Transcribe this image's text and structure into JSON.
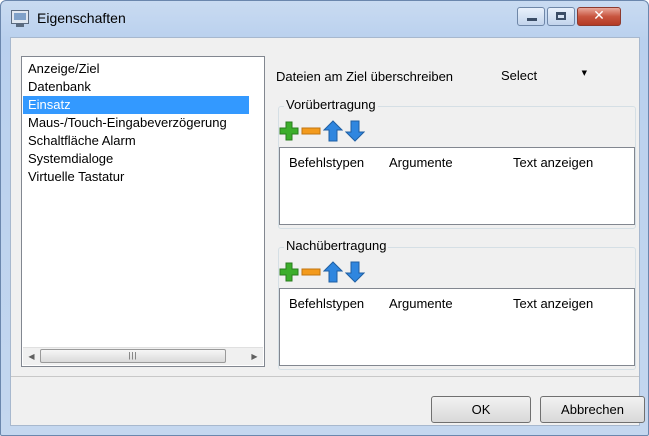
{
  "window": {
    "title": "Eigenschaften"
  },
  "sidebar": {
    "items": [
      {
        "label": "Anzeige/Ziel",
        "selected": false
      },
      {
        "label": "Datenbank",
        "selected": false
      },
      {
        "label": "Einsatz",
        "selected": true
      },
      {
        "label": "Maus-/Touch-Eingabeverzögerung",
        "selected": false
      },
      {
        "label": "Schaltfläche Alarm",
        "selected": false
      },
      {
        "label": "Systemdialoge",
        "selected": false
      },
      {
        "label": "Virtuelle Tastatur",
        "selected": false
      }
    ]
  },
  "settings": {
    "overwrite_label": "Dateien am Ziel überschreiben",
    "overwrite_value": "Select"
  },
  "pre_transfer": {
    "title": "Vorübertragung",
    "columns": [
      "Befehlstypen",
      "Argumente",
      "Text anzeigen"
    ]
  },
  "post_transfer": {
    "title": "Nachübertragung",
    "columns": [
      "Befehlstypen",
      "Argumente",
      "Text anzeigen"
    ]
  },
  "footer": {
    "ok_label": "OK",
    "cancel_label": "Abbrechen"
  },
  "colors": {
    "selection": "#3399ff",
    "add": "#3cae2b",
    "remove": "#f39a1c",
    "arrow": "#2f86df",
    "close": "#c8553f"
  },
  "icons": {
    "add": "plus-icon",
    "remove": "minus-icon",
    "up": "arrow-up-icon",
    "down": "arrow-down-icon"
  }
}
